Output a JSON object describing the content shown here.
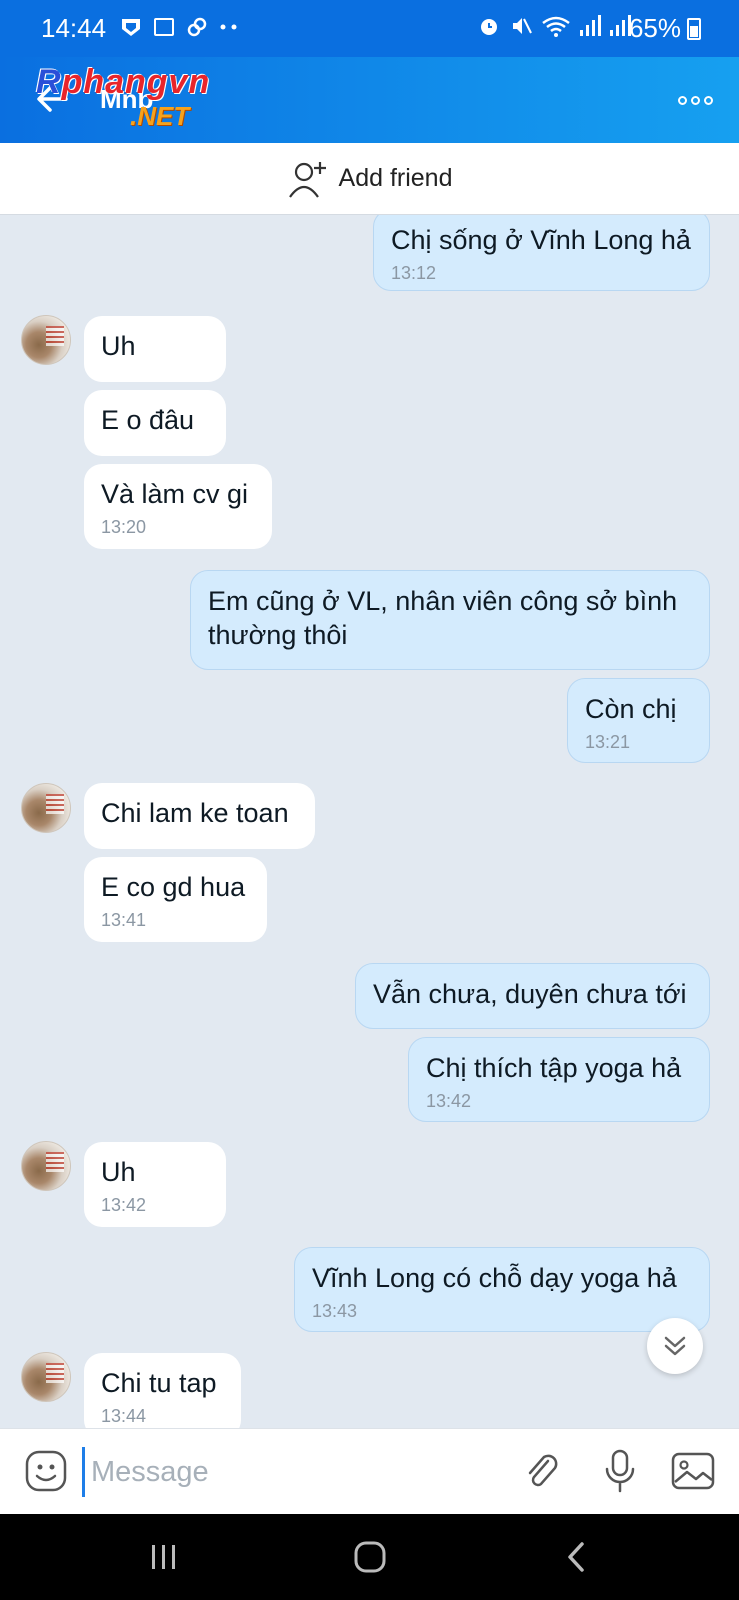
{
  "status_bar": {
    "time": "14:44",
    "battery": "65%"
  },
  "header": {
    "contact_name": "Mnb",
    "watermark_top": "Rphangvn",
    "watermark_bottom": ".NET"
  },
  "add_friend": {
    "label": "Add friend"
  },
  "messages": [
    {
      "from": "me",
      "text": "Chị sống ở Vĩnh Long hả",
      "time": "13:12"
    },
    {
      "from": "them",
      "text": "Uh",
      "time": ""
    },
    {
      "from": "them",
      "text": "E o đâu",
      "time": ""
    },
    {
      "from": "them",
      "text": "Và làm cv gi",
      "time": "13:20"
    },
    {
      "from": "me",
      "text": "Em cũng ở VL, nhân viên công sở bình thường thôi",
      "time": ""
    },
    {
      "from": "me",
      "text": "Còn chị",
      "time": "13:21"
    },
    {
      "from": "them",
      "text": "Chi lam ke toan",
      "time": ""
    },
    {
      "from": "them",
      "text": "E co gd hua",
      "time": "13:41"
    },
    {
      "from": "me",
      "text": "Vẫn chưa, duyên chưa tới",
      "time": ""
    },
    {
      "from": "me",
      "text": "Chị thích tập yoga hả",
      "time": "13:42"
    },
    {
      "from": "them",
      "text": "Uh",
      "time": "13:42"
    },
    {
      "from": "me",
      "text": "Vĩnh Long có chỗ dạy yoga hả",
      "time": "13:43"
    },
    {
      "from": "them",
      "text": "Chi tu tap",
      "time": "13:44"
    }
  ],
  "input": {
    "placeholder": "Message"
  },
  "icons": [
    "back-arrow-icon",
    "more-icon",
    "add-friend-icon",
    "emoji-icon",
    "attach-icon",
    "mic-icon",
    "image-icon",
    "scroll-down-icon",
    "recents-icon",
    "home-icon",
    "back-icon"
  ],
  "colors": {
    "header": "#0a6fe0",
    "my_bubble": "#d4ebfd",
    "their_bubble": "#ffffff",
    "chat_bg": "#e2e9f1"
  }
}
